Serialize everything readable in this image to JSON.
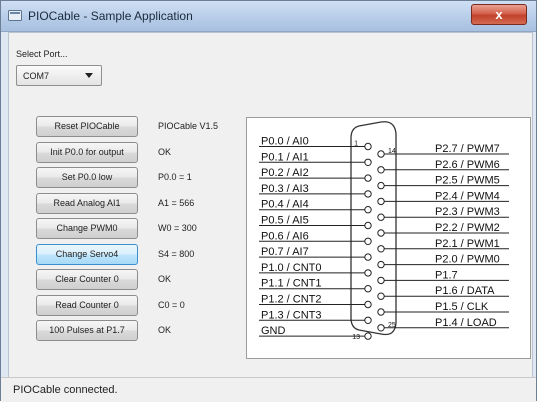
{
  "window": {
    "title": "PIOCable - Sample Application",
    "close_glyph": "x"
  },
  "port": {
    "label": "Select Port...",
    "selected": "COM7"
  },
  "actions": [
    {
      "label": "Reset PIOCable",
      "status": "PIOCable V1.5"
    },
    {
      "label": "Init P0.0 for output",
      "status": "OK"
    },
    {
      "label": "Set P0.0 low",
      "status": "P0.0 = 1"
    },
    {
      "label": "Read Analog AI1",
      "status": "A1 = 566"
    },
    {
      "label": "Change PWM0",
      "status": "W0 = 300"
    },
    {
      "label": "Change Servo4",
      "status": "S4 = 800"
    },
    {
      "label": "Clear Counter 0",
      "status": "OK"
    },
    {
      "label": "Read Counter 0",
      "status": "C0 = 0"
    },
    {
      "label": "100 Pulses at P1.7",
      "status": "OK"
    }
  ],
  "connector": {
    "left_pins": [
      "P0.0 / AI0",
      "P0.1 / AI1",
      "P0.2 / AI2",
      "P0.3 / AI3",
      "P0.4 / AI4",
      "P0.5 / AI5",
      "P0.6 / AI6",
      "P0.7 / AI7",
      "P1.0 / CNT0",
      "P1.1 / CNT1",
      "P1.2 / CNT2",
      "P1.3 / CNT3",
      "GND"
    ],
    "right_pins": [
      "P2.7 / PWM7",
      "P2.6 / PWM6",
      "P2.5 / PWM5",
      "P2.4 / PWM4",
      "P2.3 / PWM3",
      "P2.2 / PWM2",
      "P2.1 / PWM1",
      "P2.0 / PWM0",
      "P1.7",
      "P1.6 / DATA",
      "P1.5 / CLK",
      "P1.4 / LOAD"
    ],
    "pin_numbers": {
      "first": "1",
      "left_last": "13",
      "right_first": "14",
      "last": "25"
    }
  },
  "statusbar": {
    "text": "PIOCable connected."
  },
  "active_button_index": 5
}
